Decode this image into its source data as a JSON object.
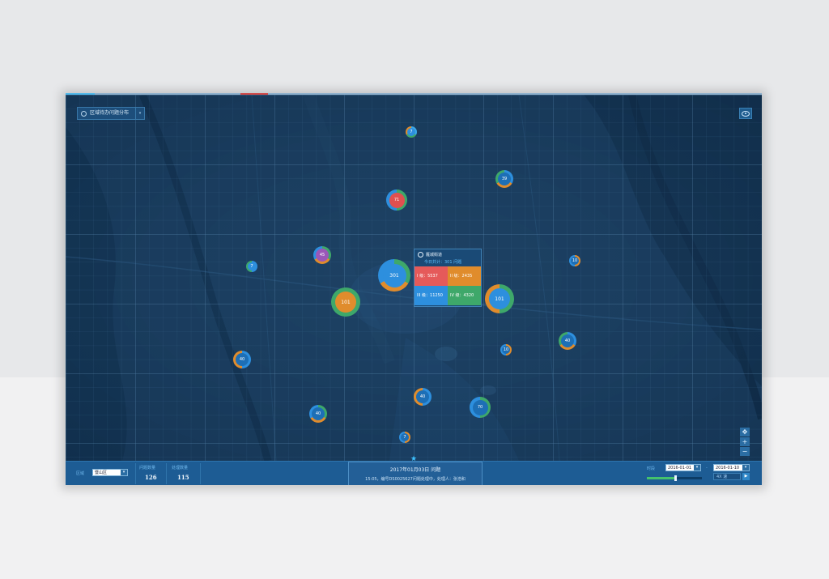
{
  "panel_title": "区域待办问题分布",
  "clusters": [
    {
      "label": "7",
      "color": "#2d8fde",
      "ring": [
        "#3aa8e8",
        "#3ea86a",
        "#e08c2c"
      ]
    },
    {
      "label": "39",
      "color": "#1d6fb6",
      "ring": [
        "#2d8fde",
        "#e08c2c",
        "#3ea86a"
      ]
    },
    {
      "label": "71",
      "color": "#e05050",
      "ring": [
        "#3ea86a",
        "#2d8fde"
      ]
    },
    {
      "label": "45",
      "color": "#9b57b8",
      "ring": [
        "#3ea86a",
        "#e08c2c",
        "#2d8fde"
      ]
    },
    {
      "label": "7",
      "color": "#2d8fde",
      "ring": [
        "#2d8fde",
        "#3ea86a"
      ]
    },
    {
      "label": "10",
      "color": "#1d6fb6",
      "ring": [
        "#e08c2c",
        "#2d8fde"
      ]
    },
    {
      "label": "301",
      "color": "#2d8fde",
      "ring": [
        "#3ea86a",
        "#e08c2c",
        "#2d8fde"
      ]
    },
    {
      "label": "101",
      "color": "#e08c2c",
      "ring": [
        "#3ea86a"
      ]
    },
    {
      "label": "101",
      "color": "#2d8fde",
      "ring": [
        "#3ea86a",
        "#e08c2c"
      ]
    },
    {
      "label": "40",
      "color": "#1d6fb6",
      "ring": [
        "#2d8fde",
        "#e08c2c"
      ]
    },
    {
      "label": "10",
      "color": "#1d6fb6",
      "ring": [
        "#e08c2c",
        "#2d8fde"
      ]
    },
    {
      "label": "40",
      "color": "#1d6fb6",
      "ring": [
        "#2d8fde",
        "#e08c2c",
        "#3ea86a"
      ]
    },
    {
      "label": "40",
      "color": "#1d6fb6",
      "ring": [
        "#2d8fde",
        "#e08c2c"
      ]
    },
    {
      "label": "40",
      "color": "#1d6fb6",
      "ring": [
        "#3ea86a",
        "#e08c2c",
        "#2d8fde"
      ]
    },
    {
      "label": "70",
      "color": "#1d6fb6",
      "ring": [
        "#3ea86a",
        "#2d8fde"
      ]
    },
    {
      "label": "7",
      "color": "#1d6fb6",
      "ring": [
        "#e08c2c",
        "#2d8fde"
      ]
    }
  ],
  "popup": {
    "title": "雁城街道",
    "subtitle": "今日共计：301 问题",
    "cells": [
      {
        "text": "I 级：5537",
        "color": "#e55a5a"
      },
      {
        "text": "II 级：2435",
        "color": "#e08c2c"
      },
      {
        "text": "III 级：11250",
        "color": "#2d8fde"
      },
      {
        "text": "IV 级：4320",
        "color": "#3ea86a"
      }
    ]
  },
  "map_controls": [
    "✥",
    "+",
    "−"
  ],
  "bottom": {
    "region_label": "区域",
    "region_value": "暨山区",
    "issue_count_label": "问题数量",
    "issue_count": "126",
    "handled_label": "处理数量",
    "handled_count": "115",
    "date_line": "2017年01月03日  问题",
    "info_line": "15:05，编号DS0025627问题处理中，处理人：张浩和",
    "time_label": "时段",
    "date_from": "2016-01-01",
    "date_sep": "-",
    "date_to": "2016-01-10",
    "speed": "4X 速",
    "progress": 0.52
  },
  "colors": {
    "accent": "#3ec2ff",
    "green": "#3ea86a",
    "orange": "#e08c2c",
    "red": "#e05050",
    "blue": "#2d8fde"
  }
}
